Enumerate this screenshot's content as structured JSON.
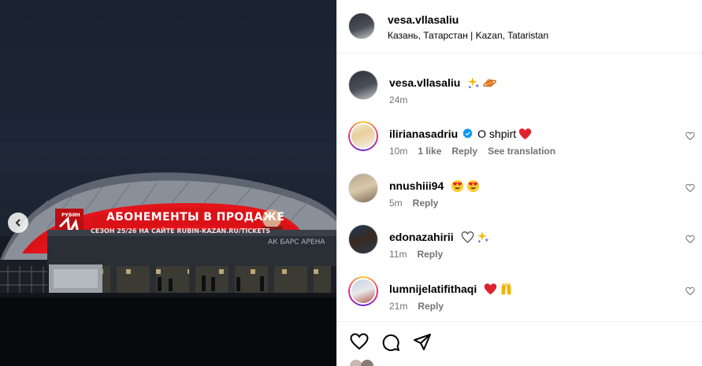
{
  "post": {
    "username": "vesa.vllasaliu",
    "location": "Казань, Татарстан | Kazan, Tataristan"
  },
  "photo": {
    "screen_title": "АБОНЕМЕНТЫ В ПРОДАЖЕ",
    "screen_subtitle": "СЕЗОН 25/26 НА САЙТЕ RUBIN-KAZAN.RU/TICKETS",
    "club_logo_text": "РУБИН",
    "arena_sign": "АК БАРС АРЕНА"
  },
  "comments": [
    {
      "username": "vesa.vllasaliu",
      "text": "",
      "emojis": [
        "sparkles-emoji",
        "planet-emoji"
      ],
      "time": "24m",
      "likes": "",
      "reply": "",
      "translate": "",
      "verified": false,
      "ring": false,
      "show_heart": false
    },
    {
      "username": "ilirianasadriu",
      "text": "O shpirt",
      "emojis": [
        "red-heart-emoji"
      ],
      "time": "10m",
      "likes": "1 like",
      "reply": "Reply",
      "translate": "See translation",
      "verified": true,
      "ring": true,
      "show_heart": true
    },
    {
      "username": "nnushiii94",
      "text": "",
      "emojis": [
        "heart-eyes-emoji",
        "heart-eyes-emoji"
      ],
      "time": "5m",
      "likes": "",
      "reply": "Reply",
      "translate": "",
      "verified": false,
      "ring": false,
      "show_heart": true
    },
    {
      "username": "edonazahirii",
      "text": "",
      "emojis": [
        "white-heart-emoji",
        "sparkles-emoji"
      ],
      "time": "11m",
      "likes": "",
      "reply": "Reply",
      "translate": "",
      "verified": false,
      "ring": false,
      "show_heart": true
    },
    {
      "username": "lumnijelatifithaqi",
      "text": "",
      "emojis": [
        "red-heart-emoji",
        "raised-hands-emoji"
      ],
      "time": "21m",
      "likes": "",
      "reply": "Reply",
      "translate": "",
      "verified": false,
      "ring": true,
      "show_heart": true
    }
  ],
  "actions": {
    "icons": [
      "heart-icon",
      "comment-icon",
      "share-icon"
    ]
  },
  "colors": {
    "meta_text": "#737373",
    "border": "#efefef",
    "verified": "#0095f6",
    "screen_red": "#e3151b"
  }
}
